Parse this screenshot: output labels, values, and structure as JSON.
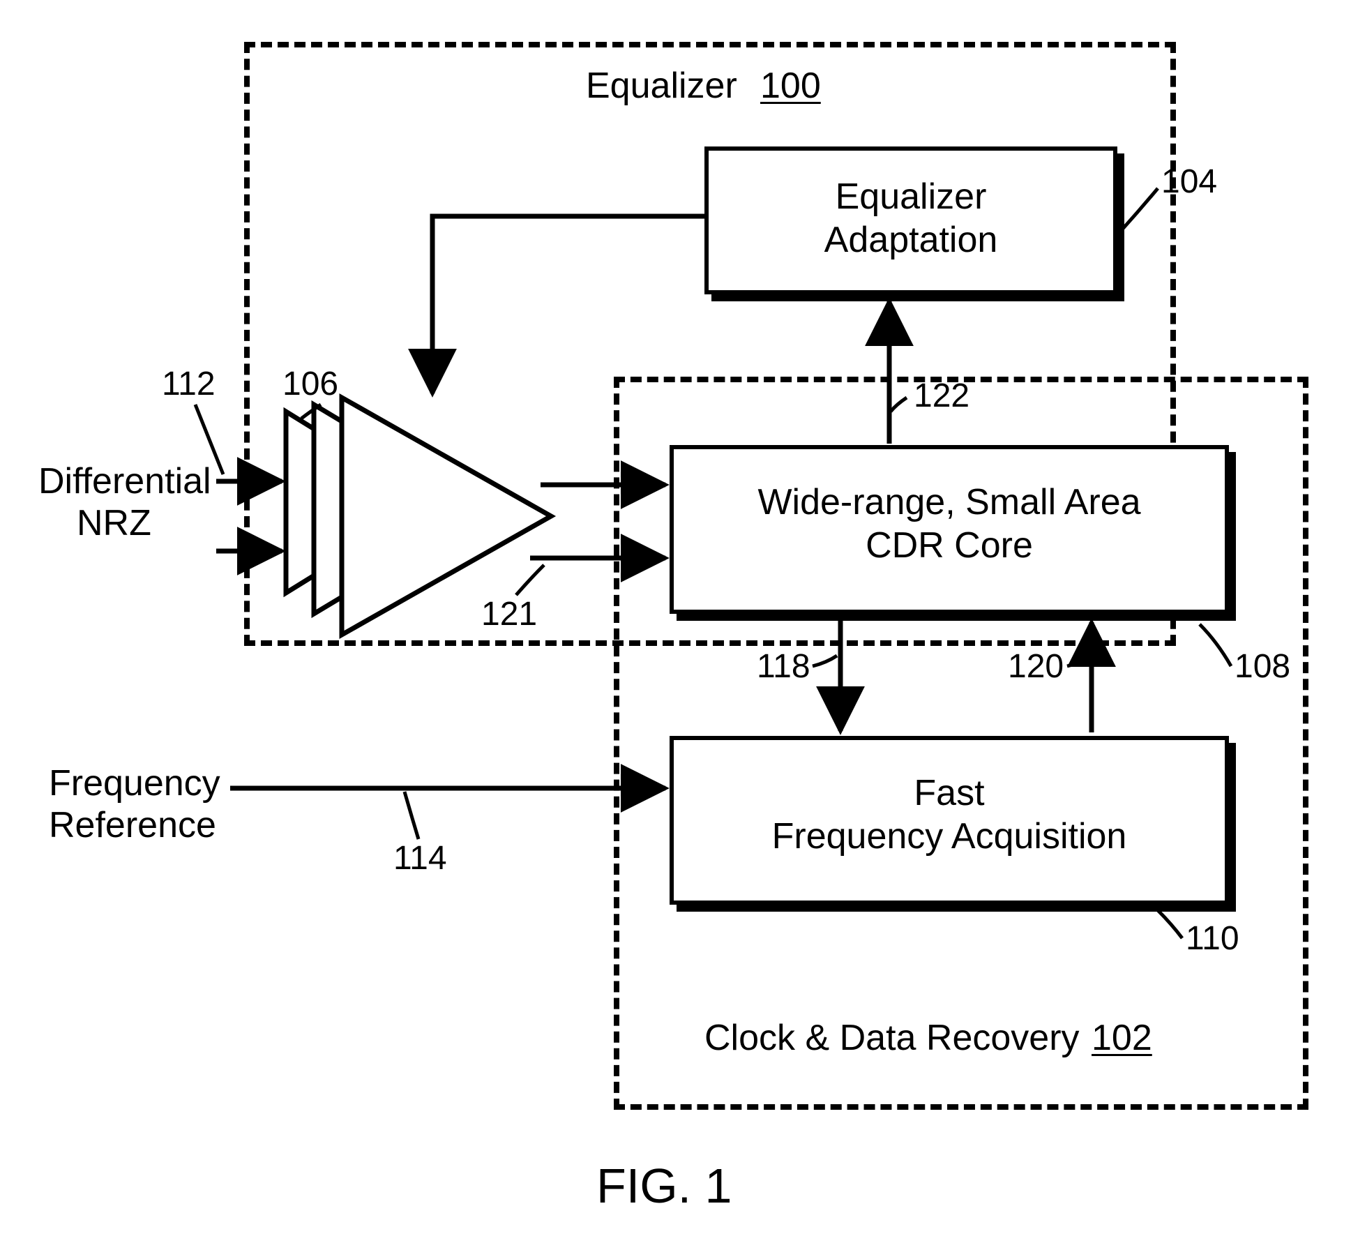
{
  "figure_label": "FIG. 1",
  "equalizer": {
    "title_label": "Equalizer",
    "title_ref": "100",
    "adaptation": {
      "line1": "Equalizer",
      "line2": "Adaptation",
      "ref": "104"
    },
    "filter_ref": "106"
  },
  "cdr_section": {
    "title_label": "Clock & Data Recovery",
    "title_ref": "102",
    "core": {
      "line1": "Wide-range, Small Area",
      "line2": "CDR Core",
      "ref": "108"
    },
    "acq": {
      "line1": "Fast",
      "line2": "Frequency Acquisition",
      "ref": "110"
    }
  },
  "inputs": {
    "nrz": {
      "line1": "Differential",
      "line2": "NRZ",
      "ref": "112"
    },
    "freq_ref": {
      "line1": "Frequency",
      "line2": "Reference",
      "ref": "114"
    }
  },
  "signals": {
    "cdr_to_acq_ref": "118",
    "acq_to_cdr_ref": "120",
    "filter_out_ref": "121",
    "cdr_to_adapt_ref": "122"
  }
}
